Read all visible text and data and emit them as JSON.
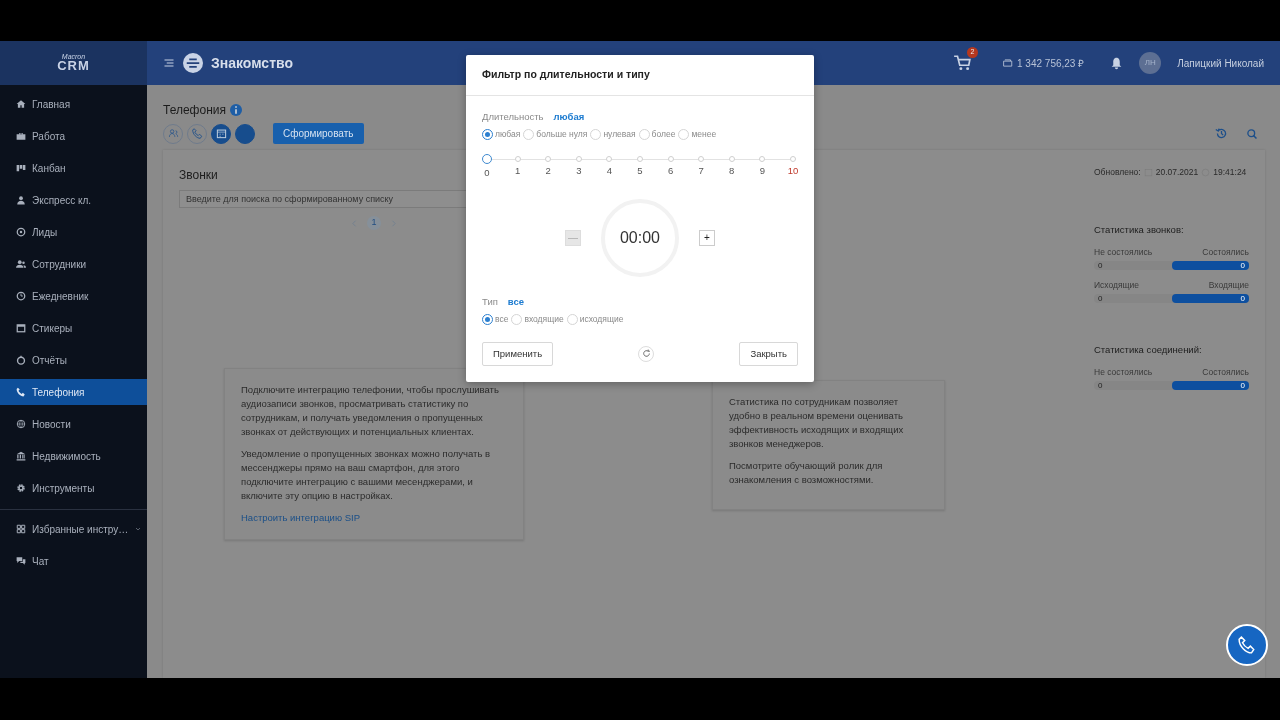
{
  "sidebar": {
    "logo": {
      "top": "Macron",
      "bottom": "CRM"
    },
    "items": [
      {
        "label": "Главная",
        "selected": false
      },
      {
        "label": "Работа",
        "selected": false
      },
      {
        "label": "Канбан",
        "selected": false
      },
      {
        "label": "Экспресс кл.",
        "selected": false
      },
      {
        "label": "Лиды",
        "selected": false
      },
      {
        "label": "Сотрудники",
        "selected": false
      },
      {
        "label": "Ежедневник",
        "selected": false
      },
      {
        "label": "Стикеры",
        "selected": false
      },
      {
        "label": "Отчёты",
        "selected": false
      },
      {
        "label": "Телефония",
        "selected": true
      },
      {
        "label": "Новости",
        "selected": false
      },
      {
        "label": "Недвижимость",
        "selected": false
      },
      {
        "label": "Инструменты",
        "selected": false
      }
    ],
    "extra_items": [
      {
        "label": "Избранные инстру…",
        "selected": false,
        "expanded": false
      },
      {
        "label": "Чат",
        "selected": false
      }
    ]
  },
  "topbar": {
    "title": "Знакомство",
    "cart_count": "2",
    "balance": "1 342 756,23 ₽",
    "avatar_initials": "ЛН",
    "user_name": "Лапицкий Николай"
  },
  "page": {
    "title": "Телефония",
    "toolbar": [
      {
        "selected": false
      },
      {
        "selected": false
      },
      {
        "selected": true
      },
      {
        "selected": true
      }
    ],
    "generate_button": "Сформировать"
  },
  "calls_panel": {
    "title": "Звонки",
    "search": {
      "placeholder": "Введите для поиска по сформированному списку"
    },
    "pages": [
      {
        "label": "1",
        "selected": true
      }
    ],
    "updated": {
      "label": "Обновлено:",
      "date": "20.07.2021",
      "time": "19:41:24"
    },
    "stats": [
      {
        "title": "Статистика звонков:",
        "rows": [
          {
            "left_label": "Не состоялись",
            "right_label": "Состоялись",
            "left_value": "0",
            "right_value": "0",
            "level": 0.5
          },
          {
            "left_label": "Исходящие",
            "right_label": "Входящие",
            "left_value": "0",
            "right_value": "0",
            "level": 0.5
          }
        ]
      },
      {
        "title": "Статистика соединений:",
        "rows": [
          {
            "left_label": "Не состоялись",
            "right_label": "Состоялись",
            "left_value": "0",
            "right_value": "0",
            "level": 0.5
          }
        ]
      }
    ],
    "info_boxes": [
      {
        "paragraphs": [
          "Подключите интеграцию телефонии, чтобы прослушивать аудиозаписи звонков, просматривать статистику по сотрудникам, и получать уведомления о пропущенных звонках от действующих и потенциальных клиентах.",
          "Уведомление о пропущенных звонках можно получать в мессенджеры прямо на ваш смартфон, для этого подключите интеграцию с вашими месенджерами, и включите эту опцию в настройках."
        ],
        "link": "Настроить интеграцию SIP"
      },
      {
        "paragraphs": [
          "Статистика по сотрудникам позволяет удобно в реальном времени оценивать эффективность исходящих и входящих звонков менеджеров.",
          "Посмотрите обучающий ролик для ознакомления с возможностями."
        ]
      }
    ]
  },
  "modal": {
    "title": "Фильтр по длительности и типу",
    "duration": {
      "label": "Длительность",
      "value": "любая",
      "options": [
        {
          "label": "любая",
          "selected": true
        },
        {
          "label": "больше нуля",
          "selected": false
        },
        {
          "label": "нулевая",
          "selected": false
        },
        {
          "label": "более",
          "selected": false
        },
        {
          "label": "менее",
          "selected": false
        }
      ],
      "scale": [
        {
          "label": "0",
          "selected": true,
          "highlighted": false
        },
        {
          "label": "1",
          "selected": false,
          "highlighted": false
        },
        {
          "label": "2",
          "selected": false,
          "highlighted": false
        },
        {
          "label": "3",
          "selected": false,
          "highlighted": false
        },
        {
          "label": "4",
          "selected": false,
          "highlighted": false
        },
        {
          "label": "5",
          "selected": false,
          "highlighted": false
        },
        {
          "label": "6",
          "selected": false,
          "highlighted": false
        },
        {
          "label": "7",
          "selected": false,
          "highlighted": false
        },
        {
          "label": "8",
          "selected": false,
          "highlighted": false
        },
        {
          "label": "9",
          "selected": false,
          "highlighted": false
        },
        {
          "label": "10",
          "selected": false,
          "highlighted": true
        }
      ]
    },
    "timer": {
      "value": "00:00",
      "decrement": {
        "label": "—",
        "disabled": true
      },
      "increment": {
        "label": "+",
        "disabled": false
      }
    },
    "type": {
      "label": "Тип",
      "value": "все",
      "options": [
        {
          "label": "все",
          "selected": true
        },
        {
          "label": "входящие",
          "selected": false
        },
        {
          "label": "исходящие",
          "selected": false
        }
      ]
    },
    "apply_button": "Применить",
    "close_button": "Закрыть"
  }
}
